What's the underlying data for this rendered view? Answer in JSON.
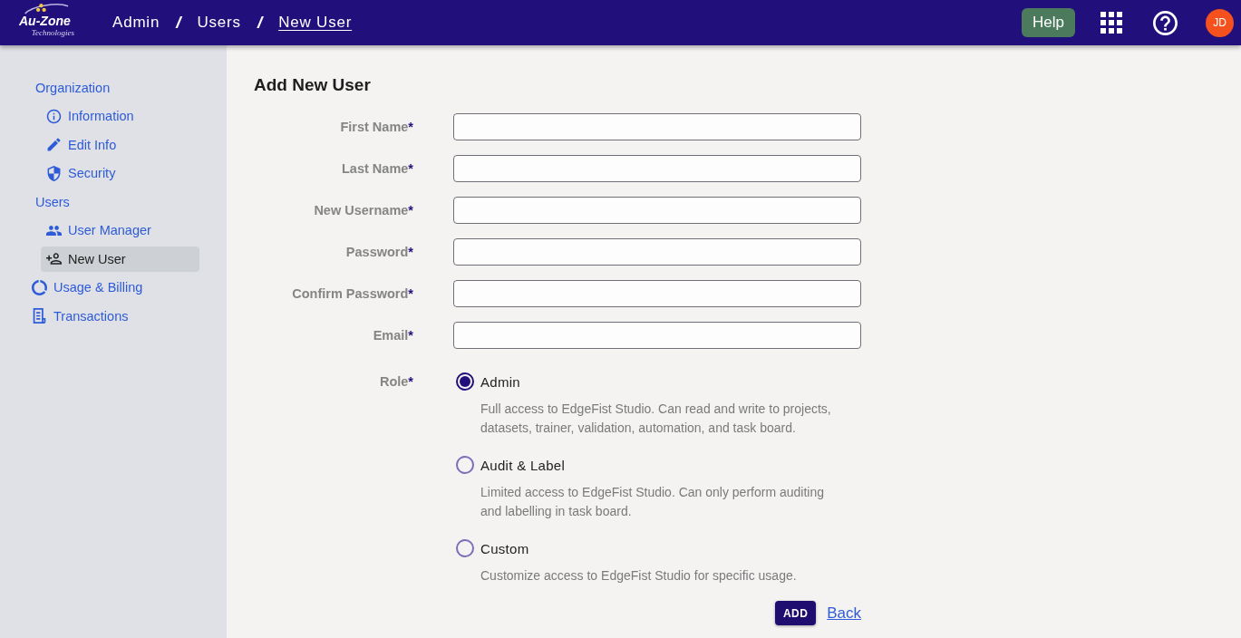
{
  "header": {
    "logo": {
      "text": "Au-Zone",
      "tagline": "Technologies"
    },
    "breadcrumb": [
      {
        "label": "Admin",
        "kind": "link"
      },
      {
        "label": "/",
        "kind": "separator"
      },
      {
        "label": "Users",
        "kind": "link"
      },
      {
        "label": "/",
        "kind": "separator"
      },
      {
        "label": "New User",
        "kind": "current"
      }
    ],
    "help_button": "Help",
    "avatar": {
      "initials": "JD"
    }
  },
  "sidebar": {
    "items": [
      {
        "label": "Organization",
        "selected": false,
        "children": [
          {
            "label": "Information",
            "selected": false
          },
          {
            "label": "Edit Info",
            "selected": false
          },
          {
            "label": "Security",
            "selected": false
          }
        ]
      },
      {
        "label": "Users",
        "selected": false,
        "children": [
          {
            "label": "User Manager",
            "selected": false
          },
          {
            "label": "New User",
            "selected": true
          }
        ]
      },
      {
        "label": "Usage & Billing",
        "selected": false
      },
      {
        "label": "Transactions",
        "selected": false
      }
    ]
  },
  "form": {
    "title": "Add New User",
    "fields": [
      {
        "label": "First Name",
        "required_mark": "*"
      },
      {
        "label": "Last Name",
        "required_mark": "*"
      },
      {
        "label": "New Username",
        "required_mark": "*"
      },
      {
        "label": "Password",
        "required_mark": "*"
      },
      {
        "label": "Confirm Password",
        "required_mark": "*"
      },
      {
        "label": "Email",
        "required_mark": "*"
      }
    ],
    "role": {
      "label": "Role",
      "required_mark": "*",
      "options": [
        {
          "label": "Admin",
          "description": "Full access to EdgeFist Studio. Can read and write to projects, datasets, trainer, validation, automation, and task board.",
          "selected": true
        },
        {
          "label": "Audit & Label",
          "description": "Limited access to EdgeFist Studio. Can only perform auditing and labelling in task board.",
          "selected": false
        },
        {
          "label": "Custom",
          "description": "Customize access to EdgeFist Studio for specific usage.",
          "selected": false
        }
      ]
    },
    "actions": {
      "add_button": "ADD",
      "back_link": "Back"
    }
  }
}
